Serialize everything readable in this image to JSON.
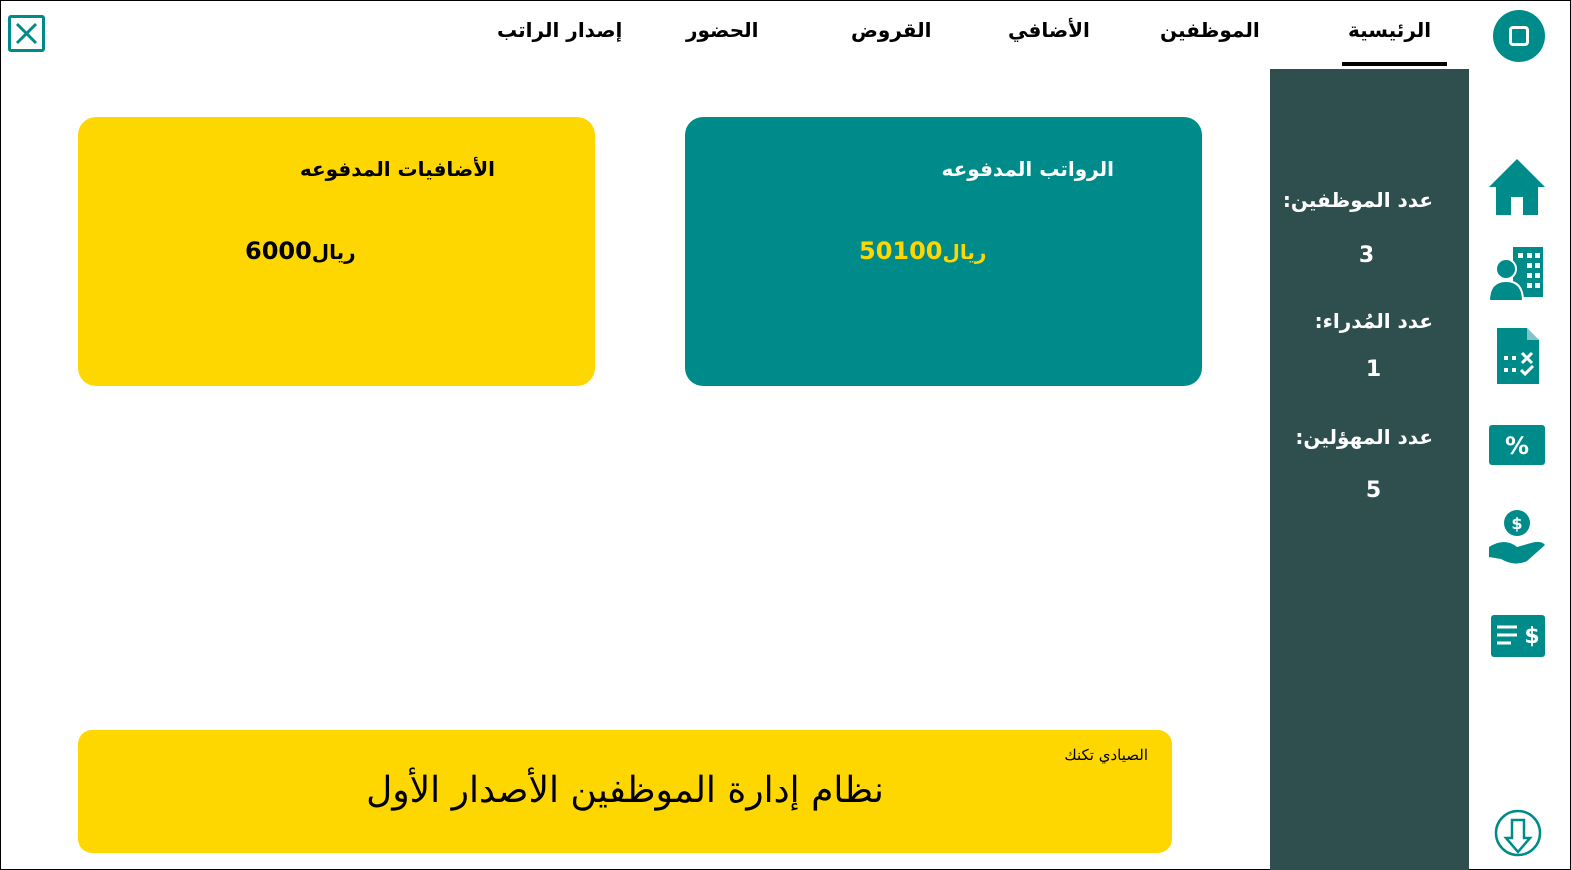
{
  "nav": {
    "tabs": [
      {
        "label": "الرئيسية",
        "active": true
      },
      {
        "label": "الموظفين"
      },
      {
        "label": "الأضافي"
      },
      {
        "label": "القروض"
      },
      {
        "label": "الحضور"
      },
      {
        "label": "إصدار الراتب"
      }
    ]
  },
  "stats": {
    "employees_label": "عدد الموظفين:",
    "employees_value": "3",
    "managers_label": "عدد المُدراء:",
    "managers_value": "1",
    "qualified_label": "عدد المهؤلين:",
    "qualified_value": "5"
  },
  "cards": {
    "salaries": {
      "title": "الرواتب المدفوعه",
      "amount": "50100",
      "currency": "ريال"
    },
    "extras": {
      "title": "الأضافيات المدفوعه",
      "amount": "6000",
      "currency": "ريال"
    }
  },
  "banner": {
    "company": "الصيادي تكنك",
    "title": "نظام إدارة الموظفين الأصدار الأول"
  },
  "colors": {
    "teal": "#008b8b",
    "yellow": "#ffd700",
    "panel": "#2f4f4f"
  },
  "icons": [
    "close-icon",
    "home-icon",
    "employees-icon",
    "attendance-icon",
    "percent-icon",
    "loan-icon",
    "salary-slip-icon",
    "download-icon"
  ]
}
